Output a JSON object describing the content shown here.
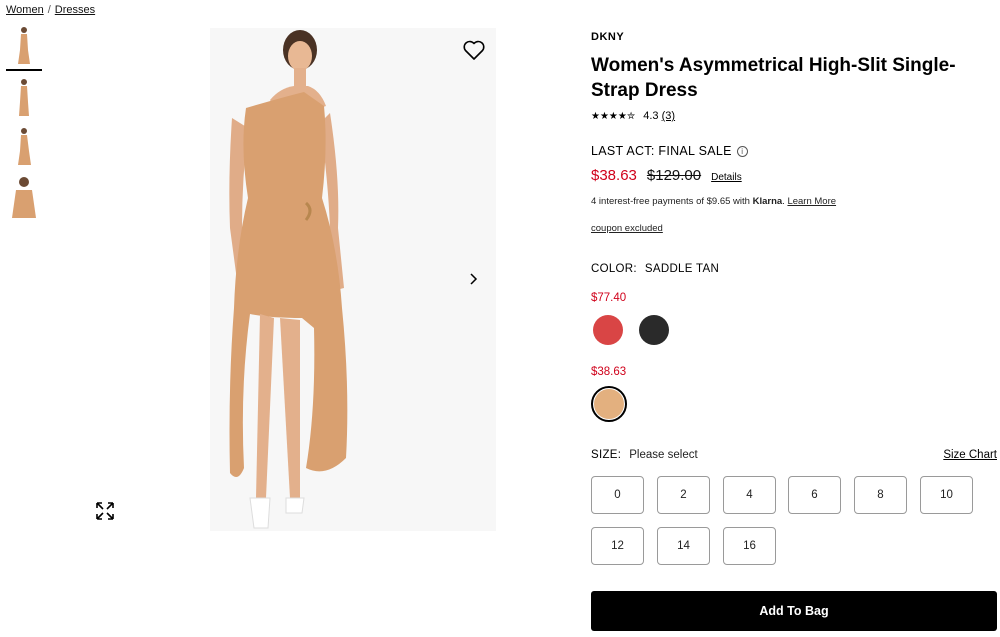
{
  "breadcrumb": {
    "items": [
      "Women",
      "Dresses"
    ],
    "separator": "/"
  },
  "product": {
    "brand": "DKNY",
    "title": "Women's Asymmetrical High-Slit Single-Strap Dress",
    "rating": {
      "stars_text": "★★★★✮",
      "value": "4.3",
      "count": "(3)"
    },
    "last_act": "LAST ACT: FINAL SALE",
    "sale_price": "$38.63",
    "original_price": "$129.00",
    "details_link": "Details",
    "klarna": {
      "prefix": "4 interest-free payments of $9.65 with",
      "brand": "Klarna",
      "suffix": ".",
      "learn_more": "Learn More"
    },
    "coupon": "coupon excluded",
    "color": {
      "label": "COLOR:",
      "value": "SADDLE TAN"
    },
    "swatch_groups": [
      {
        "price": "$77.40",
        "colors": [
          "#d94545",
          "#2a2a2a"
        ]
      },
      {
        "price": "$38.63",
        "colors": [
          "#e3b07f"
        ]
      }
    ],
    "size": {
      "label": "SIZE:",
      "prompt": "Please select",
      "chart_link": "Size Chart",
      "options": [
        "0",
        "2",
        "4",
        "6",
        "8",
        "10",
        "12",
        "14",
        "16"
      ]
    },
    "add_to_bag": "Add To Bag"
  },
  "colors": {
    "sale": "#d0021b",
    "dress": "#d9a070",
    "button": "#000000"
  }
}
